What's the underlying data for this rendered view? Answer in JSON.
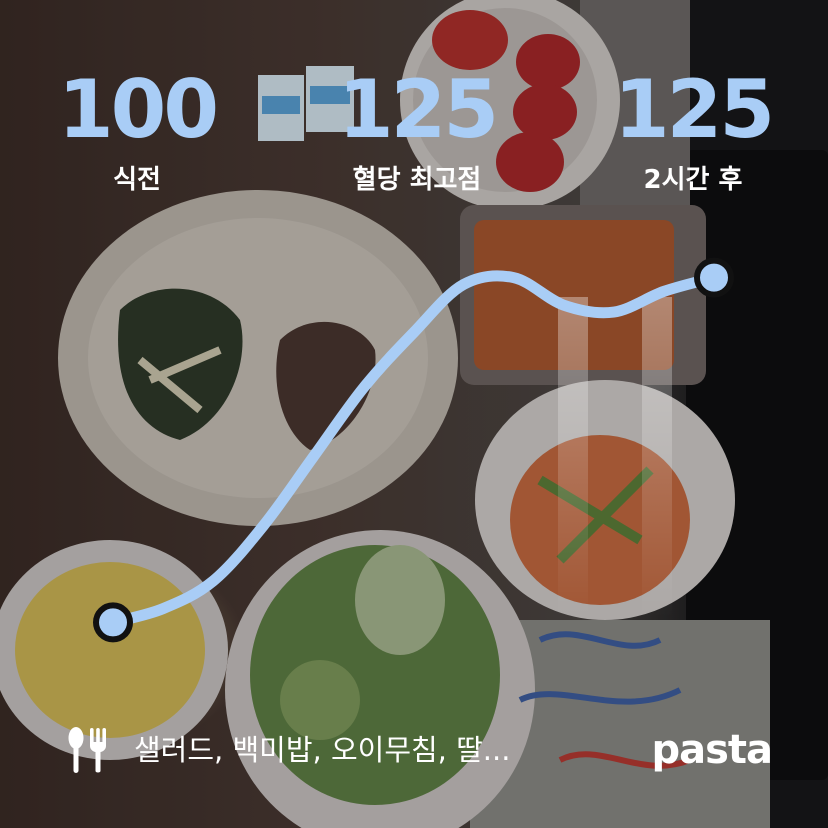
{
  "stats": {
    "before": {
      "value": "100",
      "label": "식전"
    },
    "peak": {
      "value": "125",
      "label": "혈당 최고점"
    },
    "after": {
      "value": "125",
      "label": "2시간 후"
    }
  },
  "chart_data": {
    "type": "line",
    "title": "",
    "xlabel": "",
    "ylabel": "",
    "series": [
      {
        "values": [
          100,
          101,
          103,
          107,
          112,
          117,
          121,
          124.5,
          125,
          123,
          122.5,
          124,
          125
        ]
      }
    ],
    "ylim": [
      98,
      127
    ],
    "markers": [
      "start",
      "end"
    ],
    "time_bands": [
      "peak-time",
      "2h-time"
    ],
    "color": "#a9cdf6"
  },
  "footer": {
    "meal_icon": "utensils-icon",
    "foods": "샐러드, 백미밥, 오이무침, 딸...",
    "brand": "pasta"
  }
}
